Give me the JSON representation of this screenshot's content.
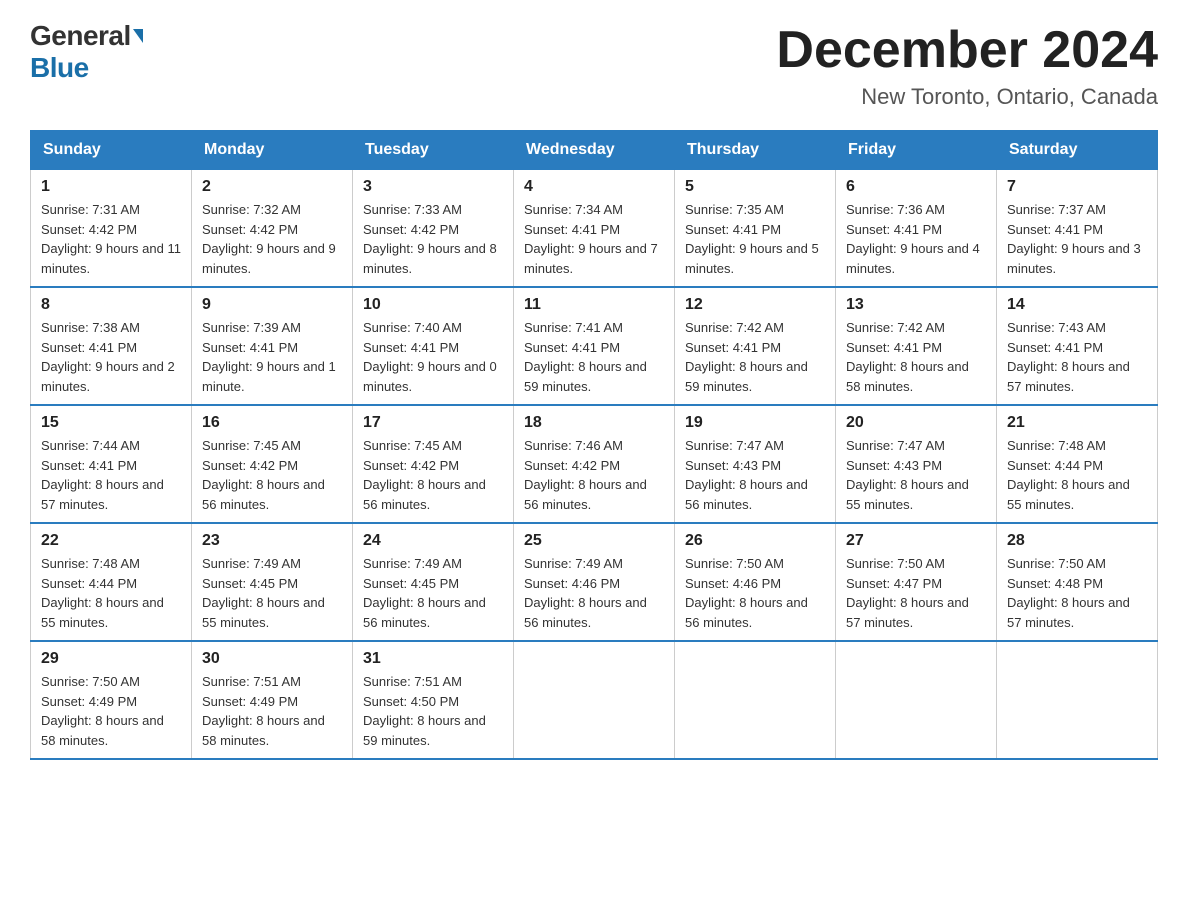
{
  "header": {
    "logo_general": "General",
    "logo_blue": "Blue",
    "month_title": "December 2024",
    "location": "New Toronto, Ontario, Canada"
  },
  "days_of_week": [
    "Sunday",
    "Monday",
    "Tuesday",
    "Wednesday",
    "Thursday",
    "Friday",
    "Saturday"
  ],
  "weeks": [
    [
      {
        "day": "1",
        "sunrise": "7:31 AM",
        "sunset": "4:42 PM",
        "daylight": "9 hours and 11 minutes."
      },
      {
        "day": "2",
        "sunrise": "7:32 AM",
        "sunset": "4:42 PM",
        "daylight": "9 hours and 9 minutes."
      },
      {
        "day": "3",
        "sunrise": "7:33 AM",
        "sunset": "4:42 PM",
        "daylight": "9 hours and 8 minutes."
      },
      {
        "day": "4",
        "sunrise": "7:34 AM",
        "sunset": "4:41 PM",
        "daylight": "9 hours and 7 minutes."
      },
      {
        "day": "5",
        "sunrise": "7:35 AM",
        "sunset": "4:41 PM",
        "daylight": "9 hours and 5 minutes."
      },
      {
        "day": "6",
        "sunrise": "7:36 AM",
        "sunset": "4:41 PM",
        "daylight": "9 hours and 4 minutes."
      },
      {
        "day": "7",
        "sunrise": "7:37 AM",
        "sunset": "4:41 PM",
        "daylight": "9 hours and 3 minutes."
      }
    ],
    [
      {
        "day": "8",
        "sunrise": "7:38 AM",
        "sunset": "4:41 PM",
        "daylight": "9 hours and 2 minutes."
      },
      {
        "day": "9",
        "sunrise": "7:39 AM",
        "sunset": "4:41 PM",
        "daylight": "9 hours and 1 minute."
      },
      {
        "day": "10",
        "sunrise": "7:40 AM",
        "sunset": "4:41 PM",
        "daylight": "9 hours and 0 minutes."
      },
      {
        "day": "11",
        "sunrise": "7:41 AM",
        "sunset": "4:41 PM",
        "daylight": "8 hours and 59 minutes."
      },
      {
        "day": "12",
        "sunrise": "7:42 AM",
        "sunset": "4:41 PM",
        "daylight": "8 hours and 59 minutes."
      },
      {
        "day": "13",
        "sunrise": "7:42 AM",
        "sunset": "4:41 PM",
        "daylight": "8 hours and 58 minutes."
      },
      {
        "day": "14",
        "sunrise": "7:43 AM",
        "sunset": "4:41 PM",
        "daylight": "8 hours and 57 minutes."
      }
    ],
    [
      {
        "day": "15",
        "sunrise": "7:44 AM",
        "sunset": "4:41 PM",
        "daylight": "8 hours and 57 minutes."
      },
      {
        "day": "16",
        "sunrise": "7:45 AM",
        "sunset": "4:42 PM",
        "daylight": "8 hours and 56 minutes."
      },
      {
        "day": "17",
        "sunrise": "7:45 AM",
        "sunset": "4:42 PM",
        "daylight": "8 hours and 56 minutes."
      },
      {
        "day": "18",
        "sunrise": "7:46 AM",
        "sunset": "4:42 PM",
        "daylight": "8 hours and 56 minutes."
      },
      {
        "day": "19",
        "sunrise": "7:47 AM",
        "sunset": "4:43 PM",
        "daylight": "8 hours and 56 minutes."
      },
      {
        "day": "20",
        "sunrise": "7:47 AM",
        "sunset": "4:43 PM",
        "daylight": "8 hours and 55 minutes."
      },
      {
        "day": "21",
        "sunrise": "7:48 AM",
        "sunset": "4:44 PM",
        "daylight": "8 hours and 55 minutes."
      }
    ],
    [
      {
        "day": "22",
        "sunrise": "7:48 AM",
        "sunset": "4:44 PM",
        "daylight": "8 hours and 55 minutes."
      },
      {
        "day": "23",
        "sunrise": "7:49 AM",
        "sunset": "4:45 PM",
        "daylight": "8 hours and 55 minutes."
      },
      {
        "day": "24",
        "sunrise": "7:49 AM",
        "sunset": "4:45 PM",
        "daylight": "8 hours and 56 minutes."
      },
      {
        "day": "25",
        "sunrise": "7:49 AM",
        "sunset": "4:46 PM",
        "daylight": "8 hours and 56 minutes."
      },
      {
        "day": "26",
        "sunrise": "7:50 AM",
        "sunset": "4:46 PM",
        "daylight": "8 hours and 56 minutes."
      },
      {
        "day": "27",
        "sunrise": "7:50 AM",
        "sunset": "4:47 PM",
        "daylight": "8 hours and 57 minutes."
      },
      {
        "day": "28",
        "sunrise": "7:50 AM",
        "sunset": "4:48 PM",
        "daylight": "8 hours and 57 minutes."
      }
    ],
    [
      {
        "day": "29",
        "sunrise": "7:50 AM",
        "sunset": "4:49 PM",
        "daylight": "8 hours and 58 minutes."
      },
      {
        "day": "30",
        "sunrise": "7:51 AM",
        "sunset": "4:49 PM",
        "daylight": "8 hours and 58 minutes."
      },
      {
        "day": "31",
        "sunrise": "7:51 AM",
        "sunset": "4:50 PM",
        "daylight": "8 hours and 59 minutes."
      },
      null,
      null,
      null,
      null
    ]
  ],
  "labels": {
    "sunrise": "Sunrise:",
    "sunset": "Sunset:",
    "daylight": "Daylight:"
  }
}
